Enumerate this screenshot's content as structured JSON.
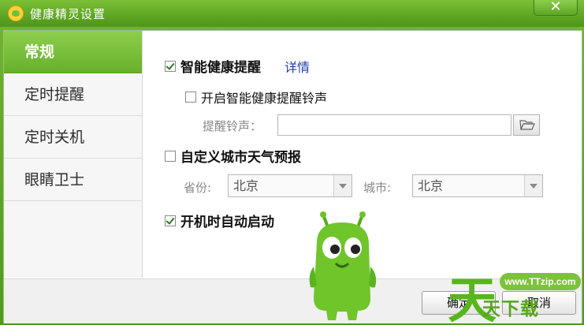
{
  "window": {
    "title": "健康精灵设置",
    "close_label": "✕"
  },
  "sidebar": {
    "items": [
      {
        "label": "常规",
        "active": true
      },
      {
        "label": "定时提醒",
        "active": false
      },
      {
        "label": "定时关机",
        "active": false
      },
      {
        "label": "眼睛卫士",
        "active": false
      }
    ]
  },
  "general": {
    "smart_reminder": {
      "label": "智能健康提醒",
      "checked": true
    },
    "details_link": "详情",
    "ringtone_toggle": {
      "label": "开启智能健康提醒铃声",
      "checked": false
    },
    "ringtone_field_label": "提醒铃声：",
    "ringtone_value": "",
    "custom_weather": {
      "label": "自定义城市天气预报",
      "checked": false
    },
    "province_label": "省份:",
    "province_value": "北京",
    "city_label": "城市:",
    "city_value": "北京",
    "autostart": {
      "label": "开机时自动启动",
      "checked": true
    }
  },
  "footer": {
    "ok_label": "确定",
    "cancel_label": "取消"
  },
  "watermark": {
    "url": "www.TTzip.com",
    "glyph": "天",
    "text": "天下载"
  },
  "colors": {
    "brand_green": "#5ea624",
    "active_tab": "#74b934",
    "link": "#1e3fa8"
  }
}
